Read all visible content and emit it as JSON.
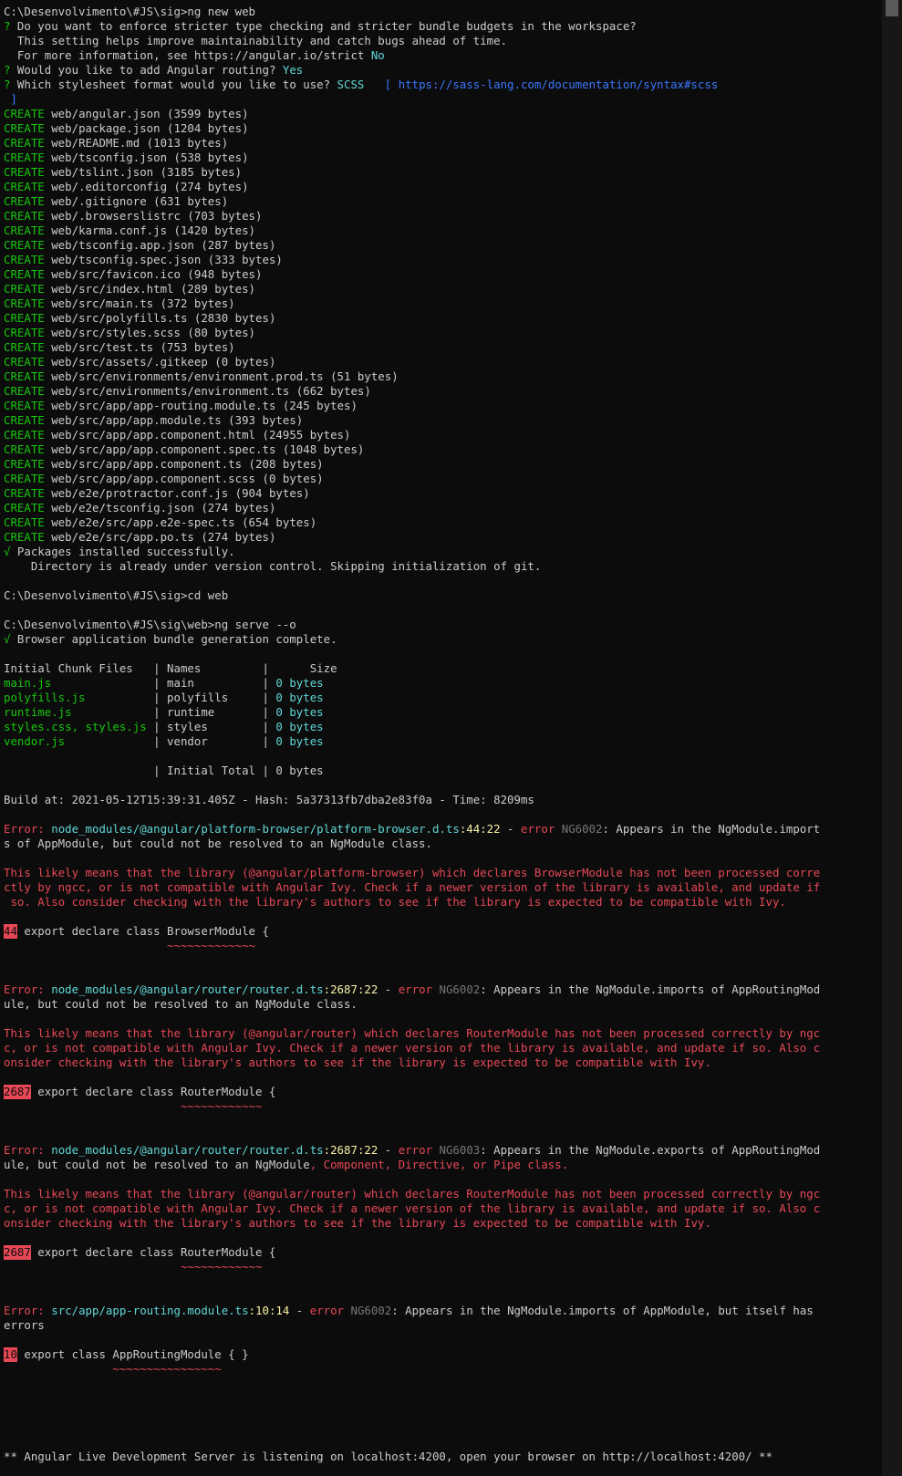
{
  "lines": [
    "C:\\Desenvolvimento\\#JS\\sig>ng new web",
    "? Do you want to enforce stricter type checking and stricter bundle budgets in the workspace?",
    "  This setting helps improve maintainability and catch bugs ahead of time.",
    "  For more information, see https://angular.io/strict No",
    "? Would you like to add Angular routing? Yes",
    "? Which stylesheet format would you like to use? SCSS   [ https://sass-lang.com/documentation/syntax#scss",
    " ]",
    "CREATE web/angular.json (3599 bytes)",
    "CREATE web/package.json (1204 bytes)",
    "CREATE web/README.md (1013 bytes)",
    "CREATE web/tsconfig.json (538 bytes)",
    "CREATE web/tslint.json (3185 bytes)",
    "CREATE web/.editorconfig (274 bytes)",
    "CREATE web/.gitignore (631 bytes)",
    "CREATE web/.browserslistrc (703 bytes)",
    "CREATE web/karma.conf.js (1420 bytes)",
    "CREATE web/tsconfig.app.json (287 bytes)",
    "CREATE web/tsconfig.spec.json (333 bytes)",
    "CREATE web/src/favicon.ico (948 bytes)",
    "CREATE web/src/index.html (289 bytes)",
    "CREATE web/src/main.ts (372 bytes)",
    "CREATE web/src/polyfills.ts (2830 bytes)",
    "CREATE web/src/styles.scss (80 bytes)",
    "CREATE web/src/test.ts (753 bytes)",
    "CREATE web/src/assets/.gitkeep (0 bytes)",
    "CREATE web/src/environments/environment.prod.ts (51 bytes)",
    "CREATE web/src/environments/environment.ts (662 bytes)",
    "CREATE web/src/app/app-routing.module.ts (245 bytes)",
    "CREATE web/src/app/app.module.ts (393 bytes)",
    "CREATE web/src/app/app.component.html (24955 bytes)",
    "CREATE web/src/app/app.component.spec.ts (1048 bytes)",
    "CREATE web/src/app/app.component.ts (208 bytes)",
    "CREATE web/src/app/app.component.scss (0 bytes)",
    "CREATE web/e2e/protractor.conf.js (904 bytes)",
    "CREATE web/e2e/tsconfig.json (274 bytes)",
    "CREATE web/e2e/src/app.e2e-spec.ts (654 bytes)",
    "CREATE web/e2e/src/app.po.ts (274 bytes)",
    "√ Packages installed successfully.",
    "    Directory is already under version control. Skipping initialization of git.",
    "",
    "C:\\Desenvolvimento\\#JS\\sig>cd web",
    "",
    "C:\\Desenvolvimento\\#JS\\sig\\web>ng serve --o",
    "√ Browser application bundle generation complete.",
    "",
    "Initial Chunk Files   | Names         |      Size",
    "main.js               | main          | 0 bytes",
    "polyfills.js          | polyfills     | 0 bytes",
    "runtime.js            | runtime       | 0 bytes",
    "styles.css, styles.js | styles        | 0 bytes",
    "vendor.js             | vendor        | 0 bytes",
    "",
    "                      | Initial Total | 0 bytes",
    "",
    "Build at: 2021-05-12T15:39:31.405Z - Hash: 5a37313fb7dba2e83f0a - Time: 8209ms",
    "",
    "Error: node_modules/@angular/platform-browser/platform-browser.d.ts:44:22 - error NG6002: Appears in the NgModule.import",
    "s of AppModule, but could not be resolved to an NgModule class.",
    "",
    "This likely means that the library (@angular/platform-browser) which declares BrowserModule has not been processed corre",
    "ctly by ngcc, or is not compatible with Angular Ivy. Check if a newer version of the library is available, and update if",
    " so. Also consider checking with the library's authors to see if the library is expected to be compatible with Ivy.",
    "",
    "44 export declare class BrowserModule {",
    "                        ~~~~~~~~~~~~~",
    "",
    "",
    "Error: node_modules/@angular/router/router.d.ts:2687:22 - error NG6002: Appears in the NgModule.imports of AppRoutingMod",
    "ule, but could not be resolved to an NgModule class.",
    "",
    "This likely means that the library (@angular/router) which declares RouterModule has not been processed correctly by ngc",
    "c, or is not compatible with Angular Ivy. Check if a newer version of the library is available, and update if so. Also c",
    "onsider checking with the library's authors to see if the library is expected to be compatible with Ivy.",
    "",
    "2687 export declare class RouterModule {",
    "                          ~~~~~~~~~~~~",
    "",
    "",
    "Error: node_modules/@angular/router/router.d.ts:2687:22 - error NG6003: Appears in the NgModule.exports of AppRoutingMod",
    "ule, but could not be resolved to an NgModule, Component, Directive, or Pipe class.",
    "",
    "This likely means that the library (@angular/router) which declares RouterModule has not been processed correctly by ngc",
    "c, or is not compatible with Angular Ivy. Check if a newer version of the library is available, and update if so. Also c",
    "onsider checking with the library's authors to see if the library is expected to be compatible with Ivy.",
    "",
    "2687 export declare class RouterModule {",
    "                          ~~~~~~~~~~~~",
    "",
    "",
    "Error: src/app/app-routing.module.ts:10:14 - error NG6002: Appears in the NgModule.imports of AppModule, but itself has",
    "errors",
    "",
    "10 export class AppRoutingModule { }",
    "                ~~~~~~~~~~~~~~~~",
    "",
    "",
    "",
    "",
    "",
    "** Angular Live Development Server is listening on localhost:4200, open your browser on http://localhost:4200/ **"
  ]
}
